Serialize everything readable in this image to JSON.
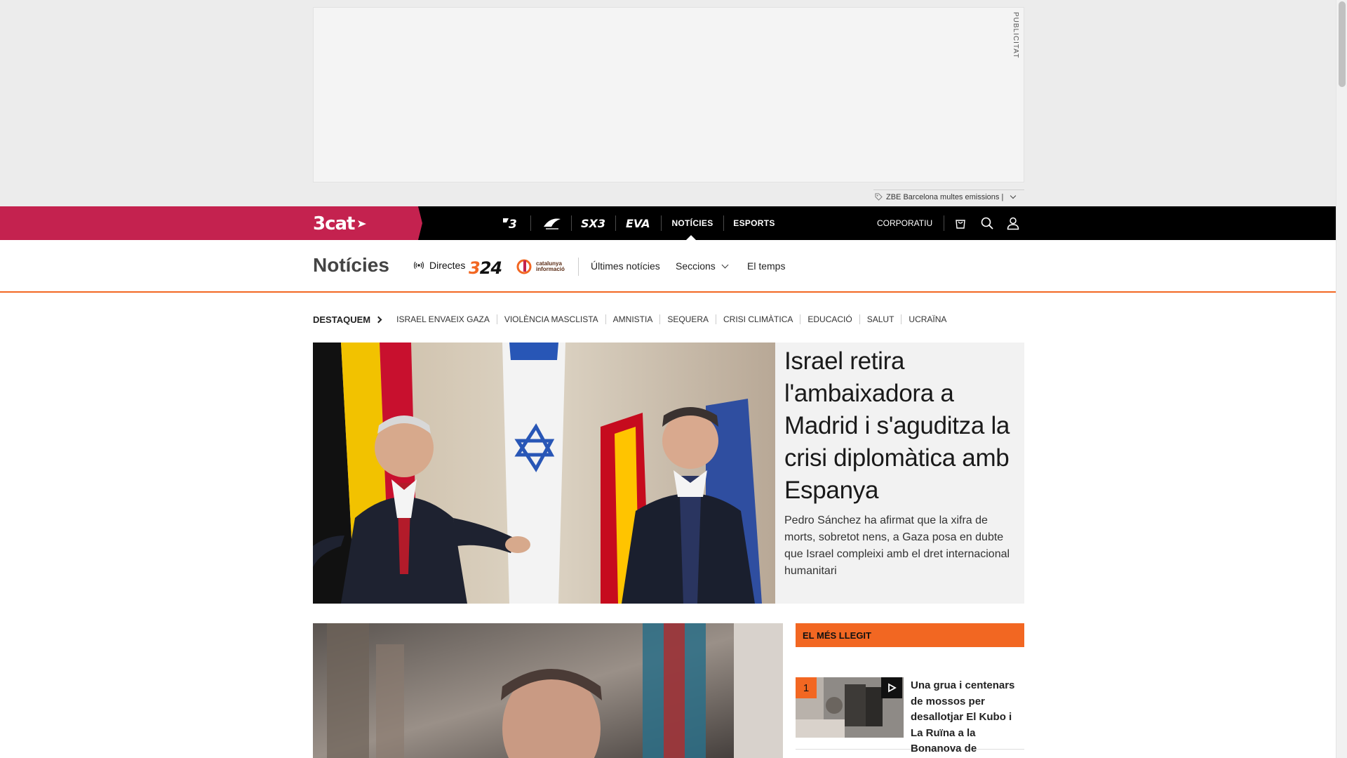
{
  "ad": {
    "label": "PUBLICITAT",
    "tag_text": "ZBE Barcelona multes emissions |"
  },
  "topnav": {
    "brand": "3cat",
    "channels": [
      "TV3",
      "Catalunya Ràdio",
      "SX3",
      "EVA"
    ],
    "links": [
      "NOTÍCIES",
      "ESPORTS"
    ],
    "active": "NOTÍCIES",
    "corporate": "CORPORATIU",
    "icons": [
      "shop-icon",
      "search-icon",
      "user-icon"
    ]
  },
  "section": {
    "title": "Notícies",
    "live_label": "Directes",
    "logo_324": "324",
    "logo_ci": "catalunya informació",
    "links": [
      "Últimes notícies",
      "Seccions",
      "El temps"
    ]
  },
  "highlights": {
    "title": "DESTAQUEM",
    "items": [
      "ISRAEL ENVAEIX GAZA",
      "VIOLÈNCIA MASCLISTA",
      "AMNISTIA",
      "SEQUERA",
      "CRISI CLIMÀTICA",
      "EDUCACIÓ",
      "SALUT",
      "UCRAÏNA"
    ]
  },
  "lead": {
    "title": "Israel retira l'ambaixadora a Madrid i s'aguditza la crisi diplomàtica amb Espanya",
    "summary": "Pedro Sánchez ha afirmat que la xifra de morts, sobretot nens, a Gaza posa en dubte que Israel compleixi amb el dret internacional humanitari"
  },
  "most_read": {
    "title": "EL MÉS LLEGIT",
    "items": [
      {
        "rank": "1",
        "title": "Una grua i centenars de mossos per desallotjar El Kubo i La Ruïna a la Bonanova de Barcelona"
      }
    ]
  },
  "colors": {
    "brand": "#c4224f",
    "accent": "#f26722",
    "nav": "#000000"
  }
}
